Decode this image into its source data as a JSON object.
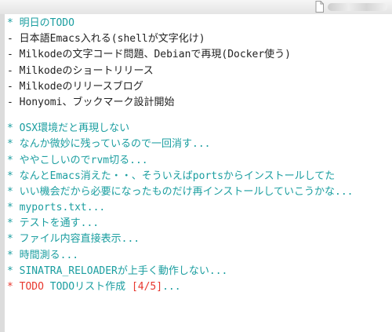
{
  "colors": {
    "heading": "#1b9ea0",
    "todo_keyword": "#e8372e",
    "text": "#222222"
  },
  "heading": {
    "bullet": "*",
    "title": "明日のTODO"
  },
  "todo_items": [
    "- 日本語Emacs入れる(shellが文字化け)",
    "- Milkodeの文字コード問題、Debianで再現(Docker使う)",
    "- Milkodeのショートリリース",
    "- Milkodeのリリースブログ",
    "- Honyomi、ブックマーク設計開始"
  ],
  "outline_items": [
    "* OSX環境だと再現しない",
    "* なんか微妙に残っているので一回消す...",
    "* ややこしいのでrvm切る...",
    "* なんとEmacs消えた・・、そういえばportsからインストールしてた",
    "* いい機会だから必要になったものだけ再インストールしていこうかな...",
    "* myports.txt...",
    "* テストを通す...",
    "* ファイル内容直接表示...",
    "* 時間測る...",
    "* SINATRA_RELOADERが上手く動作しない..."
  ],
  "todo_line": {
    "bullet": "*",
    "keyword": "TODO",
    "title": "TODOリスト作成",
    "progress": "[4/5]",
    "ellipsis": "..."
  }
}
